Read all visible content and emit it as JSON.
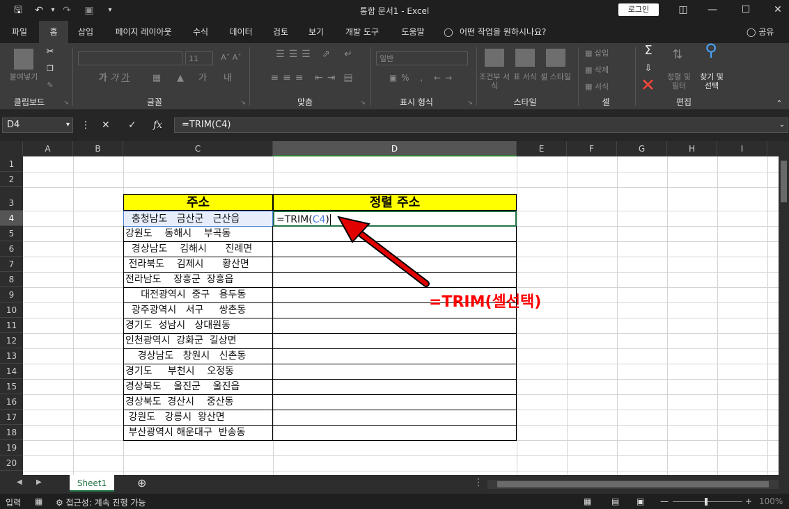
{
  "window": {
    "title": "통합 문서1  -  Excel",
    "login_label": "로그인",
    "share_label": "공유"
  },
  "tabs": [
    "파일",
    "홈",
    "삽입",
    "페이지 레이아웃",
    "수식",
    "데이터",
    "검토",
    "보기",
    "개발 도구",
    "도움말",
    "어떤 작업을 원하시나요?"
  ],
  "active_tab": "홈",
  "ribbon": {
    "clipboard": {
      "label": "클립보드",
      "paste": "붙여넣기"
    },
    "font": {
      "label": "글꼴",
      "size": "11"
    },
    "align": {
      "label": "맞춤"
    },
    "number": {
      "label": "표시 형식",
      "format": "일반"
    },
    "styles": {
      "label": "스타일",
      "cond": "조건부 서식",
      "table": "표 서식",
      "cell": "셀 스타일"
    },
    "cells": {
      "label": "셀",
      "insert": "삽입",
      "delete": "삭제",
      "format": "서식"
    },
    "editing": {
      "label": "편집",
      "sort": "정렬 및 필터",
      "find": "찾기 및 선택"
    }
  },
  "formula_bar": {
    "name_box": "D4",
    "formula": "=TRIM(C4)"
  },
  "columns": [
    "A",
    "B",
    "C",
    "D",
    "E",
    "F",
    "G",
    "H",
    "I"
  ],
  "rows": [
    "1",
    "2",
    "3",
    "4",
    "5",
    "6",
    "7",
    "8",
    "9",
    "10",
    "11",
    "12",
    "13",
    "14",
    "15",
    "16",
    "17",
    "18",
    "19",
    "20"
  ],
  "table": {
    "header_address": "주소",
    "header_sorted": "정렬 주소",
    "editing_cell_text": "=TRIM(",
    "editing_ref": "C4",
    "editing_close": ")",
    "addresses": [
      "  충청남도   금산군   근산읍",
      "강원도    동해시    부곡동",
      "  경상남도    김해시      진례면",
      " 전라북도    김제시      황산면",
      "전라남도    장흥군  장흥읍",
      "     대전광역시  중구   용두동",
      "  광주광역시   서구     쌍촌동",
      "경기도  성남시   상대원동",
      "인천광역시  강화군  길상면",
      "    경상남도   창원시   신촌동",
      "경기도     부천시    오정동",
      "경상북도    울진군    울진읍",
      "경상북도  경산시    중산동",
      " 강원도   강릉시  왕산면",
      " 부산광역시 해운대구  반송동"
    ]
  },
  "annotation": {
    "text": "=TRIM(셀선택)",
    "color": "#ff0000"
  },
  "sheet": {
    "name": "Sheet1"
  },
  "status": {
    "mode": "입력",
    "accessibility": "접근성: 계속 진행 가능",
    "zoom": "100%"
  }
}
